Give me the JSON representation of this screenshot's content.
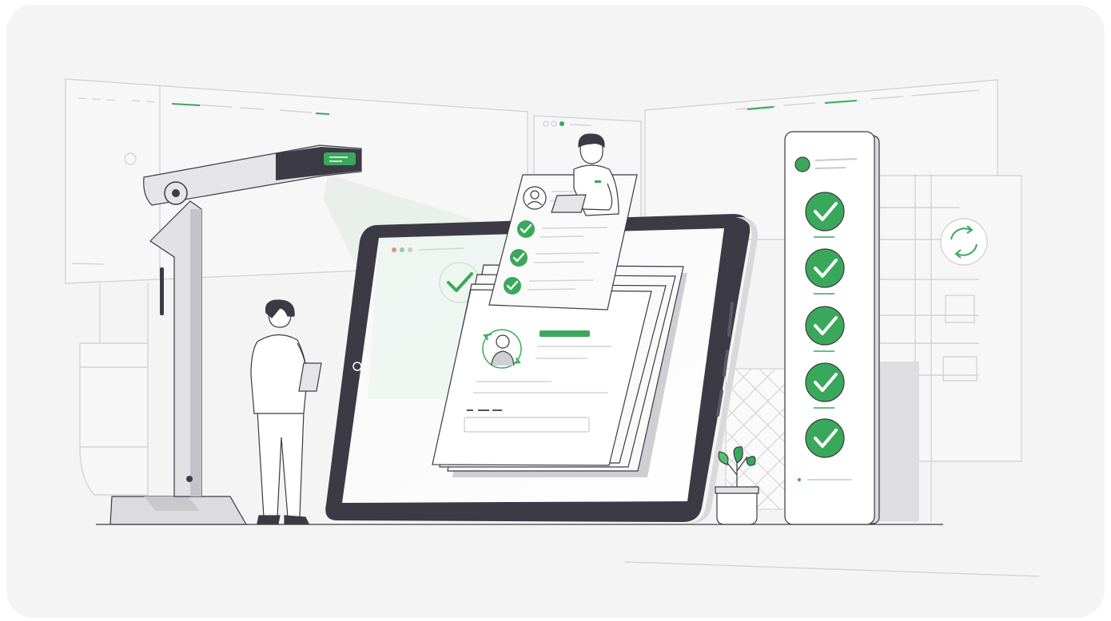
{
  "colors": {
    "accent": "#3aa85a",
    "accent_light": "#57c06f",
    "accent_dark": "#2d8a49",
    "ink": "#333340",
    "line": "#d4d4d8",
    "frame_bg": "#f4f4f5",
    "panel": "#ffffff",
    "device_dark": "#3b3a45",
    "device_gray": "#d9d9dc"
  },
  "icons": {
    "check": "check-circle-icon",
    "profile": "user-avatar-icon",
    "sync": "sync-arrows-icon",
    "plant": "potted-plant-icon"
  },
  "scene": {
    "checklist_panel_check_count": 5,
    "floating_card_check_count": 3
  }
}
